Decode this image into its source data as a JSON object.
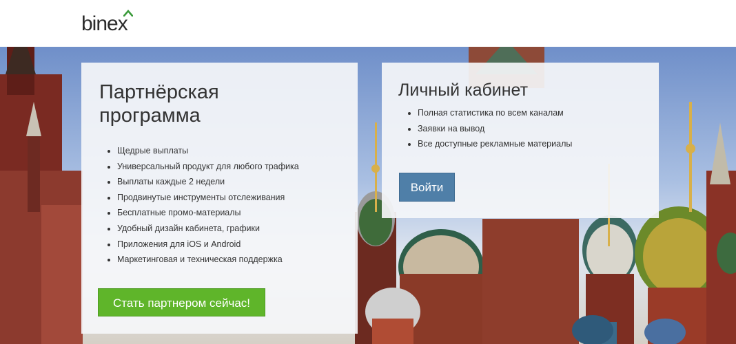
{
  "header": {
    "logo_text": "binex",
    "brand_color": "#2b2b2b",
    "accent_color": "#3a9a3a"
  },
  "partner_card": {
    "title": "Партнёрская программа",
    "features": [
      "Щедрые выплаты",
      "Универсальный продукт для любого трафика",
      "Выплаты каждые 2 недели",
      "Продвинутые инструменты отслеживания",
      "Бесплатные промо-материалы",
      "Удобный дизайн кабинета, графики",
      "Приложения для iOS и Android",
      "Маркетинговая и техническая поддержка"
    ],
    "cta_label": "Стать партнером сейчас!",
    "cta_color": "#5fb52a"
  },
  "account_card": {
    "title": "Личный кабинет",
    "features": [
      "Полная статистика по всем каналам",
      "Заявки на вывод",
      "Все доступные рекламные материалы"
    ],
    "login_label": "Войти",
    "login_color": "#4f7fa8"
  }
}
